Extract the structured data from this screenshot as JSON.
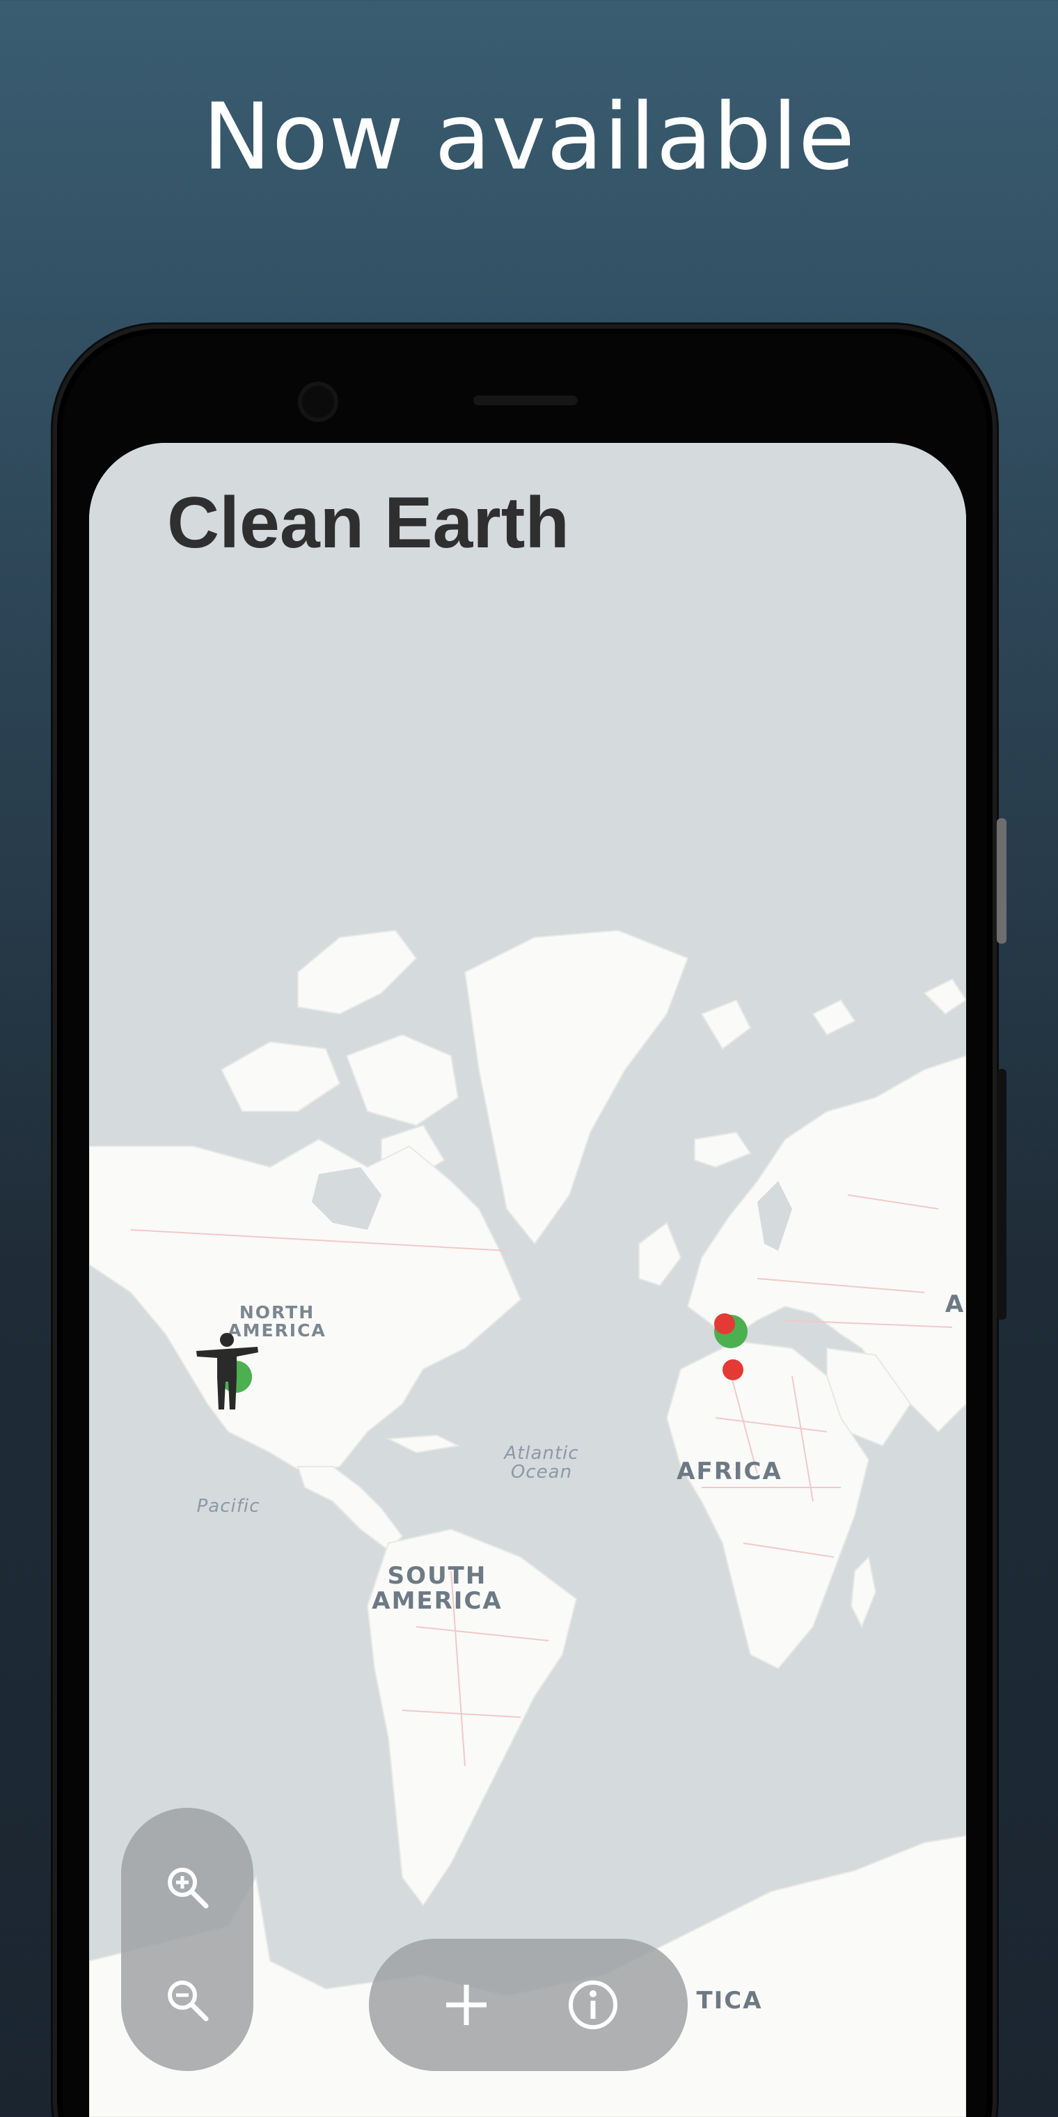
{
  "promo": {
    "headline": "Now available"
  },
  "app": {
    "title": "Clean Earth"
  },
  "map": {
    "labels": {
      "north_america": "NORTH\nAMERICA",
      "south_america": "SOUTH\nAMERICA",
      "africa": "AFRICA",
      "asia_partial": "A",
      "antarctica_partial": "TICA",
      "atlantic": "Atlantic\nOcean",
      "pacific": "Pacific"
    },
    "colors": {
      "water": "#d5dadd",
      "land": "#fafaf8",
      "border": "#f0c9c9",
      "pin_green": "#4caf50",
      "pin_red": "#e53935"
    }
  },
  "controls": {
    "zoom_in_icon": "zoom-in-icon",
    "zoom_out_icon": "zoom-out-icon",
    "add_icon": "plus-icon",
    "info_icon": "info-icon"
  }
}
